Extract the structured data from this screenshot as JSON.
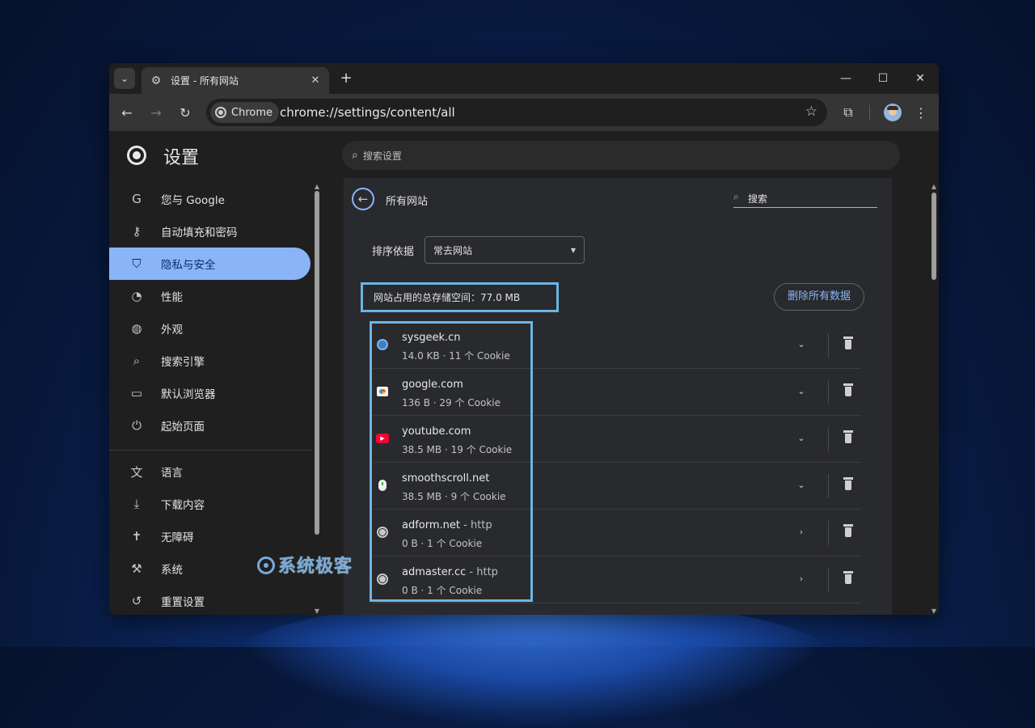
{
  "tab": {
    "title": "设置 - 所有网站",
    "icon": "gear-icon"
  },
  "omnibox": {
    "chip_label": "Chrome",
    "url": "chrome://settings/content/all"
  },
  "settings": {
    "title": "设置",
    "search_placeholder": "搜索设置"
  },
  "sidebar": {
    "items": [
      {
        "label": "您与 Google",
        "icon": "google-g-icon",
        "active": false
      },
      {
        "label": "自动填充和密码",
        "icon": "key-icon",
        "active": false
      },
      {
        "label": "隐私与安全",
        "icon": "shield-icon",
        "active": true
      },
      {
        "label": "性能",
        "icon": "speedometer-icon",
        "active": false
      },
      {
        "label": "外观",
        "icon": "palette-icon",
        "active": false
      },
      {
        "label": "搜索引擎",
        "icon": "search-icon",
        "active": false
      },
      {
        "label": "默认浏览器",
        "icon": "browser-window-icon",
        "active": false
      },
      {
        "label": "起始页面",
        "icon": "power-icon",
        "active": false
      },
      {
        "label": "语言",
        "icon": "translate-icon",
        "active": false
      },
      {
        "label": "下载内容",
        "icon": "download-icon",
        "active": false
      },
      {
        "label": "无障碍",
        "icon": "accessibility-icon",
        "active": false
      },
      {
        "label": "系统",
        "icon": "wrench-icon",
        "active": false
      },
      {
        "label": "重置设置",
        "icon": "reset-icon",
        "active": false
      }
    ]
  },
  "content": {
    "title": "所有网站",
    "search_label": "搜索",
    "sort_label": "排序依据",
    "sort_value": "常去网站",
    "storage_total": "网站占用的总存储空间：77.0 MB",
    "delete_all": "删除所有数据",
    "sites": [
      {
        "name": "sysgeek.cn",
        "protocol": "",
        "meta": "14.0 KB · 11 个 Cookie",
        "favicon": "sysgeek-favicon",
        "expander": "chevron-down-icon"
      },
      {
        "name": "google.com",
        "protocol": "",
        "meta": "136 B · 29 个 Cookie",
        "favicon": "google-favicon",
        "expander": "chevron-down-icon"
      },
      {
        "name": "youtube.com",
        "protocol": "",
        "meta": "38.5 MB · 19 个 Cookie",
        "favicon": "youtube-favicon",
        "expander": "chevron-down-icon"
      },
      {
        "name": "smoothscroll.net",
        "protocol": "",
        "meta": "38.5 MB · 9 个 Cookie",
        "favicon": "smoothscroll-favicon",
        "expander": "chevron-down-icon"
      },
      {
        "name": "adform.net",
        "protocol": " - http",
        "meta": "0 B · 1 个 Cookie",
        "favicon": "globe-icon",
        "expander": "chevron-right-icon"
      },
      {
        "name": "admaster.cc",
        "protocol": " - http",
        "meta": "0 B · 1 个 Cookie",
        "favicon": "globe-icon",
        "expander": "chevron-right-icon"
      }
    ]
  },
  "watermark": "系统极客",
  "colors": {
    "accent": "#8ab4f8",
    "highlight_box": "#6cb4e4",
    "active_text": "#062e6f"
  }
}
